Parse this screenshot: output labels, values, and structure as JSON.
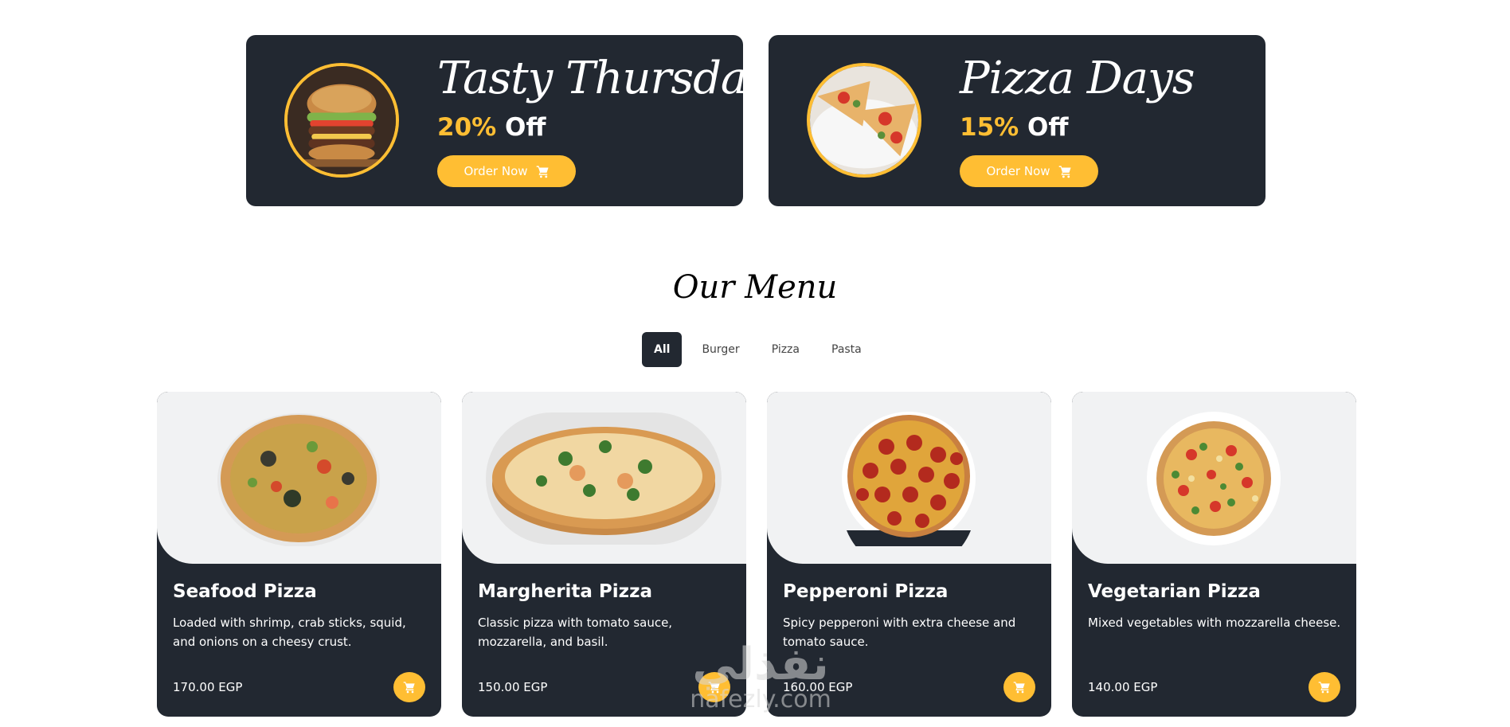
{
  "offers": [
    {
      "title": "Tasty Thursdays",
      "percent": "20%",
      "suffix": "Off",
      "button": "Order Now",
      "image": "burger-image"
    },
    {
      "title": "Pizza Days",
      "percent": "15%",
      "suffix": "Off",
      "button": "Order Now",
      "image": "pizza-slices-image"
    }
  ],
  "menu": {
    "title": "Our Menu",
    "filters": [
      "All",
      "Burger",
      "Pizza",
      "Pasta"
    ],
    "active_filter": "All",
    "items": [
      {
        "name": "Seafood Pizza",
        "description": "Loaded with shrimp, crab sticks, squid, and onions on a cheesy crust.",
        "price": "170.00 EGP"
      },
      {
        "name": "Margherita Pizza",
        "description": "Classic pizza with tomato sauce, mozzarella, and basil.",
        "price": "150.00 EGP"
      },
      {
        "name": "Pepperoni Pizza",
        "description": "Spicy pepperoni with extra cheese and tomato sauce.",
        "price": "160.00 EGP"
      },
      {
        "name": "Vegetarian Pizza",
        "description": "Mixed vegetables with mozzarella cheese.",
        "price": "140.00 EGP"
      }
    ]
  },
  "watermark": {
    "arabic": "نفذلي",
    "latin": "nafezly.com"
  },
  "colors": {
    "accent": "#ffbe33",
    "dark": "#222831",
    "card_top": "#f1f2f3"
  },
  "icons": {
    "order": "cart-icon",
    "card_action": "cart-icon"
  }
}
